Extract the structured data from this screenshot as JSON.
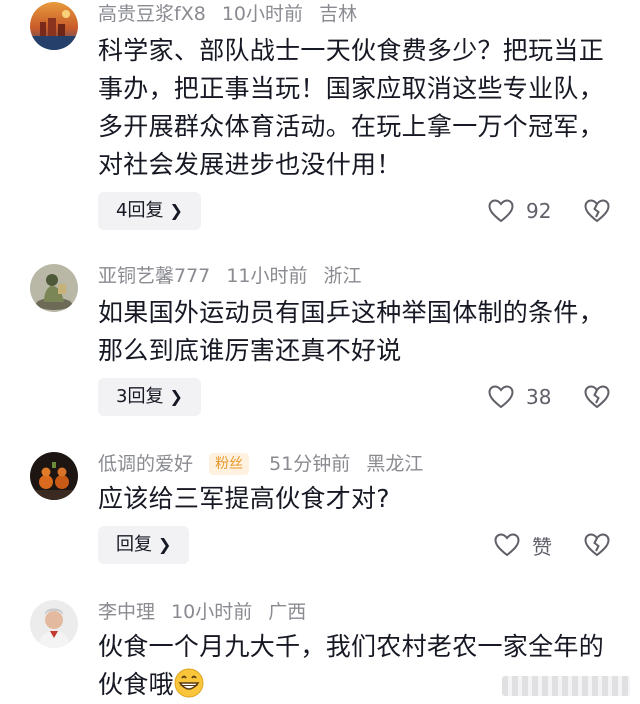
{
  "comments": [
    {
      "username": "高贵豆浆fX8",
      "time": "10小时前",
      "location": "吉林",
      "text": "科学家、部队战士一天伙食费多少？把玩当正事办，把正事当玩！国家应取消这些专业队，多开展群众体育活动。在玩上拿一万个冠军，对社会发展进步也没什用！",
      "reply_label": "4回复",
      "likes": "92",
      "avatar_icon": "avatar-landscape"
    },
    {
      "username": "亚铜艺馨777",
      "time": "11小时前",
      "location": "浙江",
      "text": "如果国外运动员有国乒这种举国体制的条件，那么到底谁厉害还真不好说",
      "reply_label": "3回复",
      "likes": "38",
      "avatar_icon": "avatar-figurine"
    },
    {
      "username": "低调的爱好",
      "badge": "粉丝",
      "time": "51分钟前",
      "location": "黑龙江",
      "text": "应该给三军提高伙食才对?",
      "reply_label": "回复",
      "likes": "赞",
      "avatar_icon": "avatar-gourds"
    },
    {
      "username": "李中理",
      "time": "10小时前",
      "location": "广西",
      "text": "伙食一个月九大千，我们农村老农一家全年的伙食哦",
      "emoji": "grinning-face-emoji",
      "avatar_icon": "avatar-person"
    }
  ],
  "colors": {
    "meta": "#8a8b91",
    "text": "#161823",
    "reply_bg": "#f2f2f4",
    "badge_bg": "#fff1df",
    "badge_fg": "#e8982a"
  }
}
